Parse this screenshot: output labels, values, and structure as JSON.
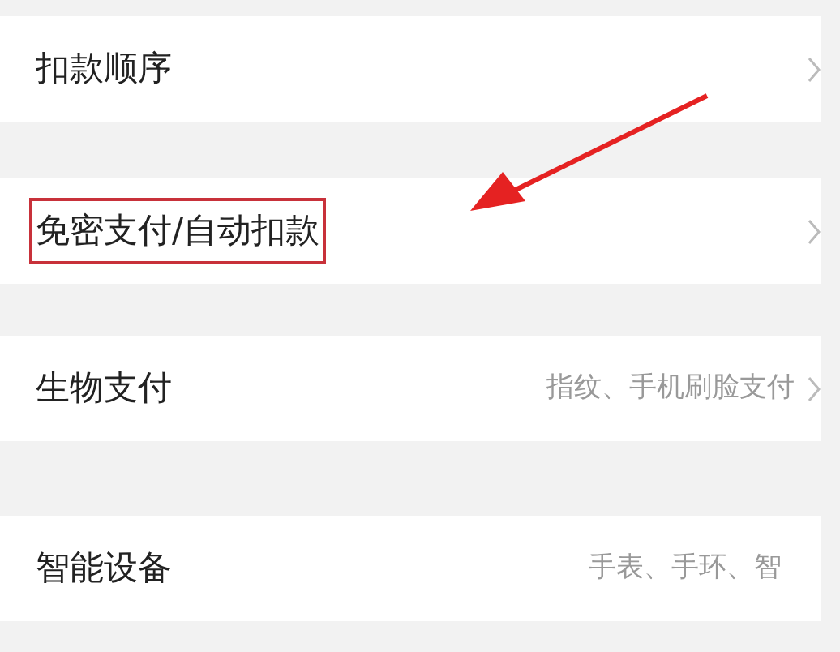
{
  "rows": [
    {
      "label": "扣款顺序",
      "chevron": true,
      "highlighted": false
    },
    {
      "label": "免密支付/自动扣款",
      "chevron": true,
      "highlighted": true
    },
    {
      "label": "生物支付",
      "value": "指纹、手机刷脸支付",
      "chevron": true,
      "highlighted": false
    },
    {
      "label": "智能设备",
      "value": "手表、手环、智",
      "chevron": false,
      "highlighted": false
    }
  ]
}
